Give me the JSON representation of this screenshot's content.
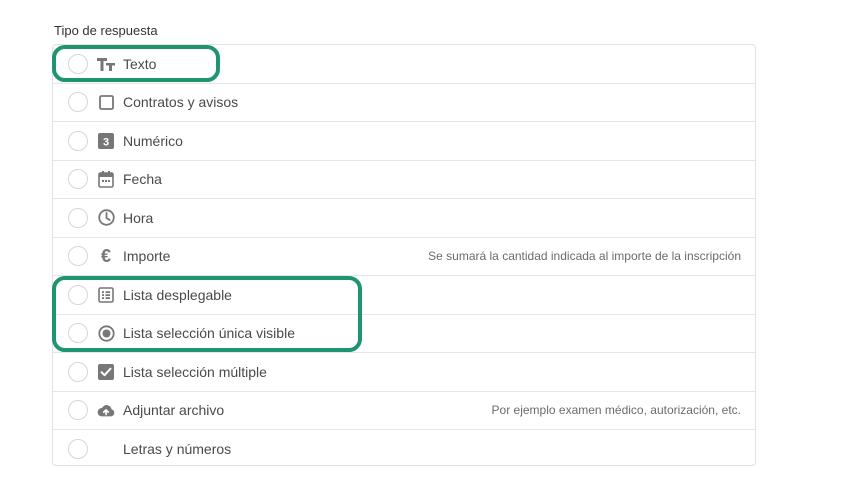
{
  "section": {
    "label": "Tipo de respuesta"
  },
  "options": [
    {
      "label": "Texto",
      "icon": "text-size-icon",
      "note": ""
    },
    {
      "label": "Contratos y avisos",
      "icon": "checkbox-outline-icon",
      "note": ""
    },
    {
      "label": "Numérico",
      "icon": "number-badge-icon",
      "badge": "3",
      "note": ""
    },
    {
      "label": "Fecha",
      "icon": "calendar-icon",
      "note": ""
    },
    {
      "label": "Hora",
      "icon": "clock-icon",
      "note": ""
    },
    {
      "label": "Importe",
      "icon": "euro-icon",
      "symbol": "€",
      "note": "Se sumará la cantidad indicada al importe de la inscripción"
    },
    {
      "label": "Lista desplegable",
      "icon": "list-icon",
      "note": ""
    },
    {
      "label": "Lista selección única visible",
      "icon": "radio-selected-icon",
      "note": ""
    },
    {
      "label": "Lista selección múltiple",
      "icon": "checkbox-checked-icon",
      "note": ""
    },
    {
      "label": "Adjuntar archivo",
      "icon": "cloud-upload-icon",
      "note": "Por ejemplo examen médico, autorización, etc."
    },
    {
      "label": "Letras y números",
      "icon": "",
      "note": ""
    }
  ],
  "colors": {
    "highlight": "#1e9470",
    "border": "#e2e2e2",
    "icon": "#777777"
  }
}
